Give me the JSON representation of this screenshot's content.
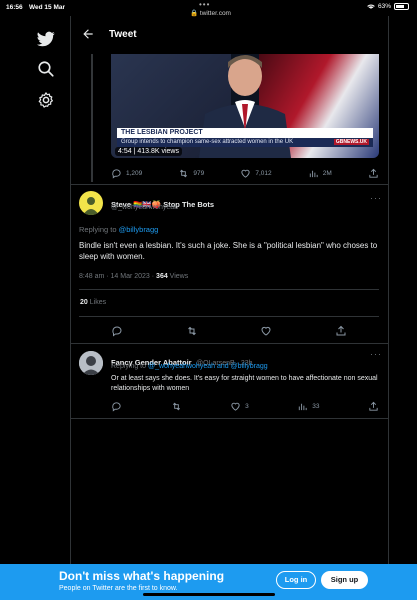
{
  "status_bar": {
    "time": "16:56",
    "date": "Wed 15 Mar",
    "url": "twitter.com",
    "battery": "63%"
  },
  "header": {
    "title": "Tweet"
  },
  "nav": {
    "icons": [
      "twitter-logo-icon",
      "search-icon",
      "settings-gear-icon"
    ]
  },
  "media": {
    "banner_title": "THE LESBIAN PROJECT",
    "banner_sub": "Group intends to champion same-sex attracted women in the UK",
    "channel": "GBNEWS.UK",
    "duration": "4:54",
    "views": "413.8K views"
  },
  "quoted_actions": {
    "replies": "1,209",
    "retweets": "979",
    "likes": "7,012",
    "views": "2M"
  },
  "tweet": {
    "name": "Steve 🏳️‍🌈🇬🇧🍑 Stop The Bots",
    "handle": "@_wohyeahwohyeah",
    "replying_prefix": "Replying to ",
    "replying_to": "@billybragg",
    "text": "Bindle isn't even a lesbian. It's such a joke. She is a \"political lesbian\" who choses to sleep with women.",
    "time": "8:48 am · 14 Mar 2023 · ",
    "views_count": "364",
    "views_label": " Views",
    "likes_count": "20",
    "likes_label": " Likes"
  },
  "reply": {
    "name": "Fancy Gender Abattoir",
    "handle": "@OLarsenB · 23h",
    "replying_prefix": "Replying to ",
    "replying_to": "@_wohyeahwohyeah and @billybragg",
    "text": "Or at least says she does. It's easy for straight women to have affectionate non sexual relationships with women",
    "retweets": "3",
    "views": "33"
  },
  "bottom": {
    "headline": "Don't miss what's happening",
    "subline": "People on Twitter are the first to know.",
    "login": "Log in",
    "signup": "Sign up"
  },
  "colors": {
    "accent": "#1d9bf0",
    "background": "#000000",
    "muted": "#71767b"
  }
}
